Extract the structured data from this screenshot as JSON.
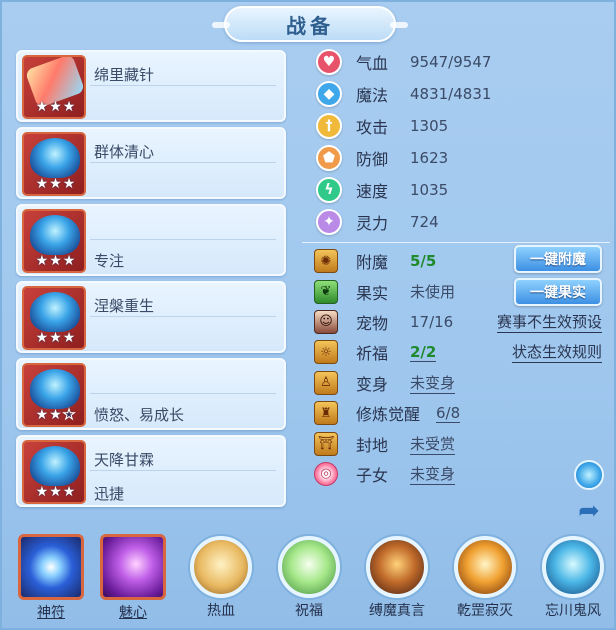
{
  "title": "战备",
  "skills": [
    {
      "name_top": "绵里藏针",
      "name_bottom": "",
      "stars_filled": 3,
      "stars_total": 3,
      "icon": "popsicle-skill-icon"
    },
    {
      "name_top": "群体清心",
      "name_bottom": "",
      "stars_filled": 3,
      "stars_total": 3,
      "icon": "helmet-skill-icon"
    },
    {
      "name_top": "",
      "name_bottom": "专注",
      "stars_filled": 3,
      "stars_total": 3,
      "icon": "crown-skill-icon"
    },
    {
      "name_top": "涅槃重生",
      "name_bottom": "",
      "stars_filled": 3,
      "stars_total": 3,
      "icon": "phoenix-skill-icon"
    },
    {
      "name_top": "",
      "name_bottom": "愤怒、易成长",
      "stars_filled": 2,
      "stars_total": 3,
      "icon": "mask-skill-icon"
    },
    {
      "name_top": "天降甘霖",
      "name_bottom": "迅捷",
      "stars_filled": 3,
      "stars_total": 3,
      "icon": "armor-skill-icon"
    }
  ],
  "stars_text": {
    "s0": "★★★",
    "s1": "★★★",
    "s2": "★★★",
    "s3": "★★★",
    "s4a": "★★",
    "s4b": "★",
    "s5": "★★★"
  },
  "stats": [
    {
      "label": "气血",
      "value": "9547/9547",
      "icon": "heart-icon",
      "color": "#e8536c"
    },
    {
      "label": "魔法",
      "value": "4831/4831",
      "icon": "diamond-icon",
      "color": "#3ea8ea"
    },
    {
      "label": "攻击",
      "value": "1305",
      "icon": "sword-icon",
      "color": "#f0b93a"
    },
    {
      "label": "防御",
      "value": "1623",
      "icon": "shield-icon",
      "color": "#f09a4a"
    },
    {
      "label": "速度",
      "value": "1035",
      "icon": "lightning-icon",
      "color": "#2fc98a"
    },
    {
      "label": "灵力",
      "value": "724",
      "icon": "spirit-icon",
      "color": "#b98ae6"
    }
  ],
  "attrs": [
    {
      "label": "附魔",
      "value": "5/5",
      "icon": "enchant-icon"
    },
    {
      "label": "果实",
      "value": "未使用",
      "icon": "fruit-icon"
    },
    {
      "label": "宠物",
      "value": "17/16",
      "icon": "pet-avatar-icon"
    },
    {
      "label": "祈福",
      "value": "2/2",
      "icon": "blessing-icon"
    },
    {
      "label": "变身",
      "value": "未变身",
      "icon": "transform-icon"
    },
    {
      "label": "修炼觉醒",
      "value": "6/8",
      "icon": "cultivation-icon"
    },
    {
      "label": "封地",
      "value": "未受赏",
      "icon": "fief-icon"
    },
    {
      "label": "子女",
      "value": "未变身",
      "icon": "child-icon"
    }
  ],
  "buttons": {
    "one_click_enchant": "一键附魔",
    "one_click_fruit": "一键果实",
    "event_no_preset": "赛事不生效预设",
    "status_rules": "状态生效规则"
  },
  "bottom": [
    {
      "label": "神符",
      "type": "square",
      "icon": "talisman-icon"
    },
    {
      "label": "魅心",
      "type": "square",
      "icon": "charm-icon"
    },
    {
      "label": "热血",
      "type": "round",
      "icon": "hot-blood-icon"
    },
    {
      "label": "祝福",
      "type": "round",
      "icon": "blessing-leaf-icon"
    },
    {
      "label": "缚魔真言",
      "type": "round",
      "icon": "demon-bind-icon"
    },
    {
      "label": "乾罡寂灭",
      "type": "round",
      "icon": "qiangang-icon"
    },
    {
      "label": "忘川鬼风",
      "type": "round",
      "icon": "ghost-wind-icon"
    }
  ],
  "colors": {
    "panel_bg": "#a9cdf0",
    "accent_green": "#1f8a2c",
    "button_blue": "#3c8fe3",
    "skill_frame_red": "#c8413b"
  }
}
